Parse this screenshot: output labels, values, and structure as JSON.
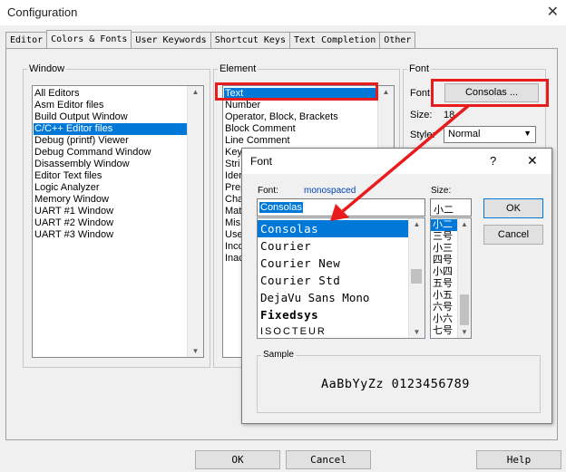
{
  "window": {
    "title": "Configuration",
    "close_glyph": "✕"
  },
  "tabs": [
    {
      "label": "Editor"
    },
    {
      "label": "Colors & Fonts",
      "active": true
    },
    {
      "label": "User Keywords"
    },
    {
      "label": "Shortcut Keys"
    },
    {
      "label": "Text Completion"
    },
    {
      "label": "Other"
    }
  ],
  "window_group": {
    "label": "Window",
    "items": [
      "All Editors",
      "Asm Editor files",
      "Build Output Window",
      "C/C++ Editor files",
      "Debug (printf) Viewer",
      "Debug Command Window",
      "Disassembly Window",
      "Editor Text files",
      "Logic Analyzer",
      "Memory Window",
      "UART #1 Window",
      "UART #2 Window",
      "UART #3 Window"
    ],
    "selected": "C/C++ Editor files"
  },
  "element_group": {
    "label": "Element",
    "items": [
      "Text",
      "Number",
      "Operator, Block, Brackets",
      "Block Comment",
      "Line Comment",
      "Key",
      "Stri",
      "Iden",
      "Prep",
      "Cha",
      "Mat",
      "Mis",
      "Use",
      "Inco",
      "Inac"
    ],
    "selected": "Text"
  },
  "font_group": {
    "label": "Font",
    "font_label": "Font:",
    "font_button": "Consolas ...",
    "size_label": "Size:",
    "size_value": "18",
    "style_label": "Style:",
    "style_value": "Normal"
  },
  "footer": {
    "ok": "OK",
    "cancel": "Cancel",
    "help": "Help"
  },
  "font_dialog": {
    "title": "Font",
    "help_glyph": "?",
    "close_glyph": "✕",
    "font_label": "Font:",
    "font_hint": "monospaced",
    "font_value": "Consolas",
    "fonts": [
      "Consolas",
      "Courier",
      "Courier New",
      "Courier Std",
      "DejaVu Sans Mono",
      "Fixedsys",
      "ISOCTEUR"
    ],
    "selected_font": "Consolas",
    "size_label": "Size:",
    "size_value": "小二",
    "sizes": [
      "小二",
      "三号",
      "小三",
      "四号",
      "小四",
      "五号",
      "小五",
      "六号",
      "小六",
      "七号"
    ],
    "selected_size": "小二",
    "ok": "OK",
    "cancel": "Cancel",
    "sample_label": "Sample",
    "sample_text": "AaBbYyZz 0123456789"
  },
  "colors": {
    "accent": "#0078d7",
    "annotation_red": "#e81c1c",
    "hint_blue": "#0046b4"
  }
}
